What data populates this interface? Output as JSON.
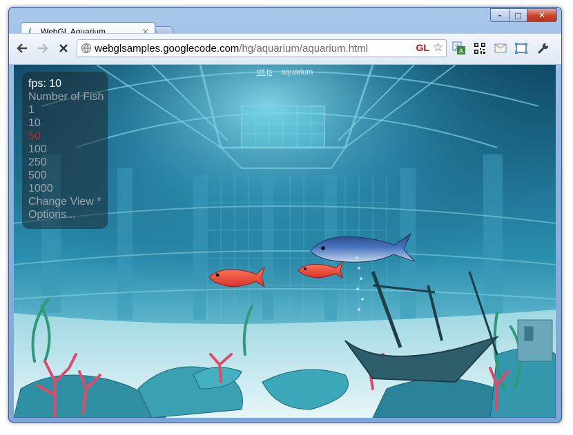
{
  "window": {
    "min_label": "–",
    "max_label": "□",
    "close_label": "✕"
  },
  "tab": {
    "title": "WebGL Aquarium",
    "close": "×"
  },
  "toolbar": {
    "url_host": "webglsamples.googlecode.com",
    "url_path": "/hg/aquarium/aquarium.html",
    "gl_badge": "GL"
  },
  "page": {
    "links": [
      "tdl.js",
      "aquarium"
    ]
  },
  "menu": {
    "fps": "fps: 10",
    "items": [
      "Number of Fish",
      "1",
      "10",
      "50",
      "100",
      "250",
      "500",
      "1000",
      "Change View *",
      "Options..."
    ],
    "selected_item": "50",
    "selected_color": "#d3201b"
  },
  "colors": {
    "water_deep": "#0f4a66",
    "water_light": "#bfe6ee"
  }
}
